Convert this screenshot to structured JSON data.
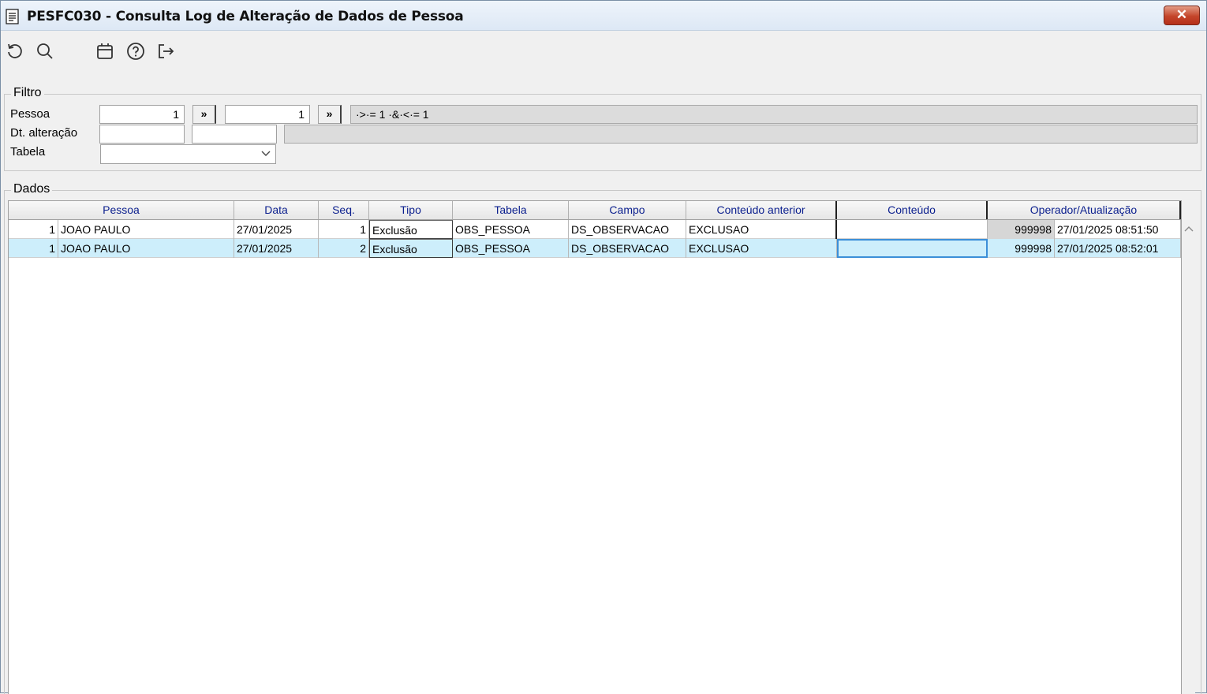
{
  "window": {
    "title": "PESFC030 - Consulta Log de Alteração de Dados de Pessoa",
    "close_label": "✕"
  },
  "toolbar": {
    "items": [
      "refresh-icon",
      "search-icon",
      "calendar-icon",
      "help-icon",
      "exit-icon"
    ]
  },
  "filter": {
    "legend": "Filtro",
    "pessoa_label": "Pessoa",
    "pessoa_from": "1",
    "pessoa_to": "1",
    "lookup_label": "»",
    "pessoa_expression": "·>·= 1 ·&·<·= 1",
    "dt_label": "Dt. alteração",
    "dt_from": "",
    "dt_to": "",
    "dt_expression": "",
    "tabela_label": "Tabela",
    "tabela_value": ""
  },
  "data": {
    "legend": "Dados",
    "columns": [
      "Pessoa",
      "Data",
      "Seq.",
      "Tipo",
      "Tabela",
      "Campo",
      "Conteúdo anterior",
      "Conteúdo",
      "Operador/Atualização"
    ],
    "rows": [
      {
        "pessoa_id": "1",
        "pessoa_nome": "JOAO PAULO",
        "data": "27/01/2025",
        "seq": "1",
        "tipo": "Exclusão",
        "tabela": "OBS_PESSOA",
        "campo": "DS_OBSERVACAO",
        "conteudo_anterior": "EXCLUSAO",
        "conteudo": "",
        "operador": "999998",
        "atualizacao": "27/01/2025 08:51:50"
      },
      {
        "pessoa_id": "1",
        "pessoa_nome": "JOAO PAULO",
        "data": "27/01/2025",
        "seq": "2",
        "tipo": "Exclusão",
        "tabela": "OBS_PESSOA",
        "campo": "DS_OBSERVACAO",
        "conteudo_anterior": "EXCLUSAO",
        "conteudo": "",
        "operador": "999998",
        "atualizacao": "27/01/2025 08:52:01"
      }
    ],
    "selected_row_color": "#cdeefb",
    "header_text_color": "#0b1f8e"
  }
}
